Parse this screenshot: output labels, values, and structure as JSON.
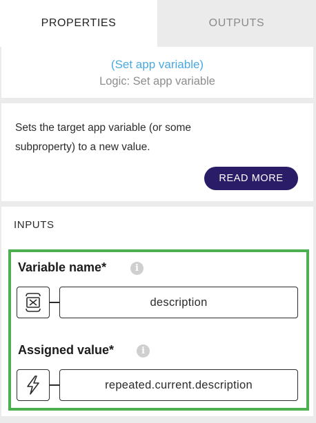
{
  "tabs": [
    {
      "label": "PROPERTIES",
      "active": true
    },
    {
      "label": "OUTPUTS",
      "active": false
    }
  ],
  "header": {
    "node_link": "(Set app variable)",
    "node_type": "Logic: Set app variable"
  },
  "description": {
    "text": "Sets the target app variable (or some subproperty) to a new value.",
    "read_more_label": "READ MORE"
  },
  "inputs": {
    "title": "INPUTS",
    "fields": [
      {
        "label": "Variable name*",
        "icon": "variable-icon",
        "value": "description"
      },
      {
        "label": "Assigned value*",
        "icon": "formula-lightning-icon",
        "value": "repeated.current.description"
      }
    ]
  },
  "colors": {
    "accent_link": "#4aa8e0",
    "button_bg": "#2a1c67",
    "highlight_border": "#4caf50",
    "panel_bg": "#ebebeb"
  }
}
